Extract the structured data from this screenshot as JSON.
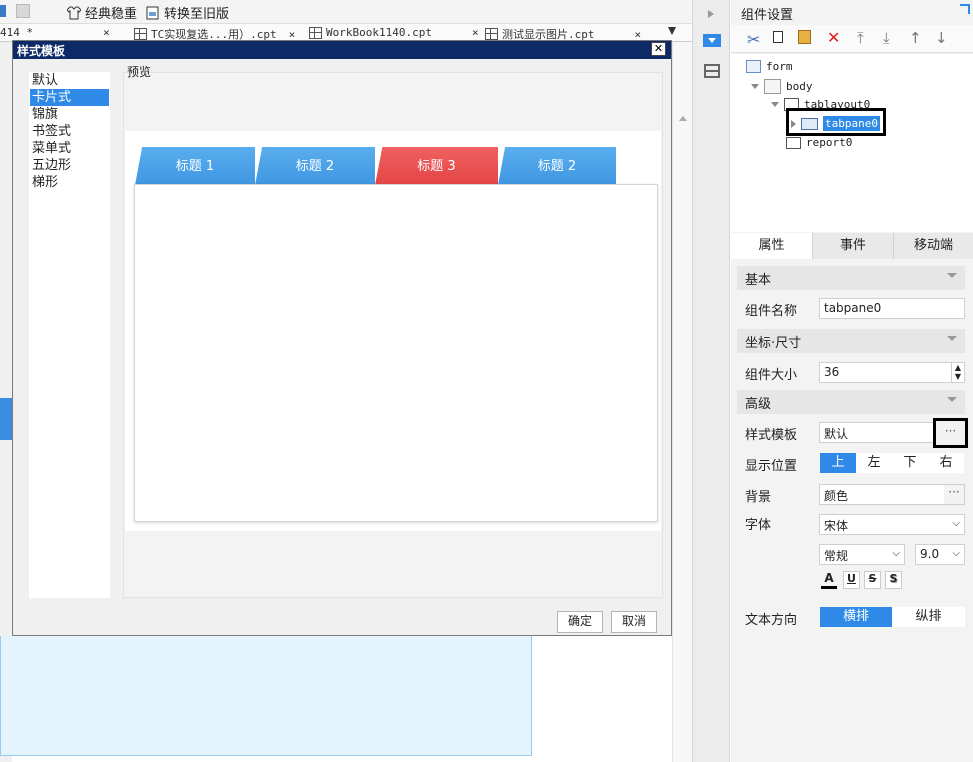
{
  "toolbar": {
    "classic_label": "经典稳重",
    "convert_label": "转换至旧版"
  },
  "file_tabs": [
    {
      "label": "414 *"
    },
    {
      "label": "TC实现复选...用）.cpt"
    },
    {
      "label": "WorkBook1140.cpt"
    },
    {
      "label": "测试显示图片.cpt"
    }
  ],
  "dialog": {
    "title": "样式模板",
    "close_symbol": "✕",
    "styles": [
      "默认",
      "卡片式",
      "锦旗",
      "书签式",
      "菜单式",
      "五边形",
      "梯形"
    ],
    "selected_style": "卡片式",
    "preview_label": "预览",
    "preview_tabs": [
      "标题 1",
      "标题 2",
      "标题 3",
      "标题 2"
    ],
    "active_tab_index": 2,
    "ok_label": "确定",
    "cancel_label": "取消"
  },
  "component_panel": {
    "title": "组件设置",
    "tree": {
      "form": "form",
      "body": "body",
      "tablayout": "tablayout0",
      "tabpane": "tabpane0",
      "report": "report0"
    },
    "tabs": [
      "属性",
      "事件",
      "移动端"
    ],
    "sections": {
      "basic": "基本",
      "position": "坐标·尺寸",
      "advanced": "高级"
    },
    "props": {
      "name_label": "组件名称",
      "name_value": "tabpane0",
      "size_label": "组件大小",
      "size_value": "36",
      "template_label": "样式模板",
      "template_value": "默认",
      "position_label": "显示位置",
      "positions": [
        "上",
        "左",
        "下",
        "右"
      ],
      "bg_label": "背景",
      "bg_value": "颜色",
      "font_label": "字体",
      "font_value": "宋体",
      "font_style": "常规",
      "font_size": "9.0",
      "text_dir_label": "文本方向",
      "text_dirs": [
        "横排",
        "纵排"
      ]
    }
  },
  "colors": {
    "accent": "#2e8ae6",
    "tab_blue": "#4aa2e8",
    "tab_red": "#e84a4a",
    "title_bar": "#0e2a66"
  }
}
